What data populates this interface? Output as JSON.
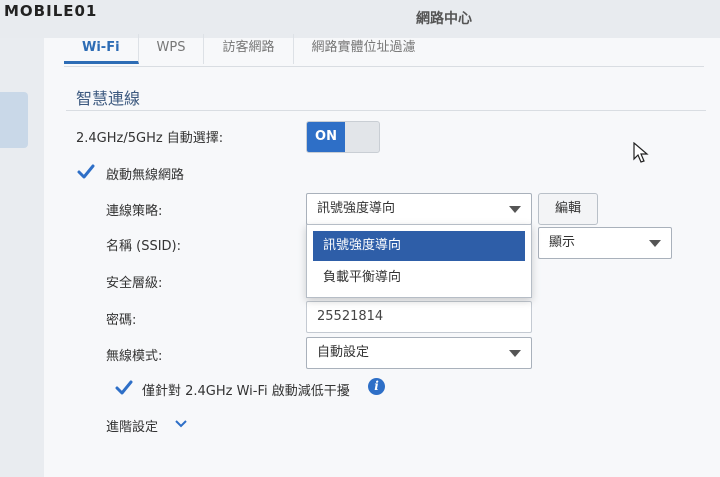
{
  "watermark": "MOBILE01",
  "window_title": "網路中心",
  "tabs": [
    {
      "label": "Wi-Fi",
      "active": true
    },
    {
      "label": "WPS",
      "active": false
    },
    {
      "label": "訪客網路",
      "active": false
    },
    {
      "label": "網路實體位址過濾",
      "active": false
    }
  ],
  "section_title": "智慧連線",
  "smart_connect": {
    "label": "2.4GHz/5GHz 自動選擇:",
    "toggle_label": "ON"
  },
  "enable_wireless": {
    "label": "啟動無線網路",
    "checked": true
  },
  "strategy": {
    "label": "連線策略:",
    "value": "訊號強度導向",
    "edit_button": "編輯"
  },
  "ssid": {
    "label": "名稱 (SSID):",
    "visibility": "顯示"
  },
  "security": {
    "label": "安全層級:"
  },
  "password": {
    "label": "密碼:",
    "value": "25521814"
  },
  "wireless_mode": {
    "label": "無線模式:",
    "value": "自動設定"
  },
  "interference": {
    "label": "僅針對 2.4GHz Wi-Fi 啟動減低干擾",
    "checked": true
  },
  "advanced": {
    "label": "進階設定"
  },
  "dropdown_options": [
    "訊號強度導向",
    "負載平衡導向"
  ],
  "colors": {
    "accent": "#2e6fc7",
    "selected": "#2e5ea8",
    "section_title": "#3d5a80"
  }
}
